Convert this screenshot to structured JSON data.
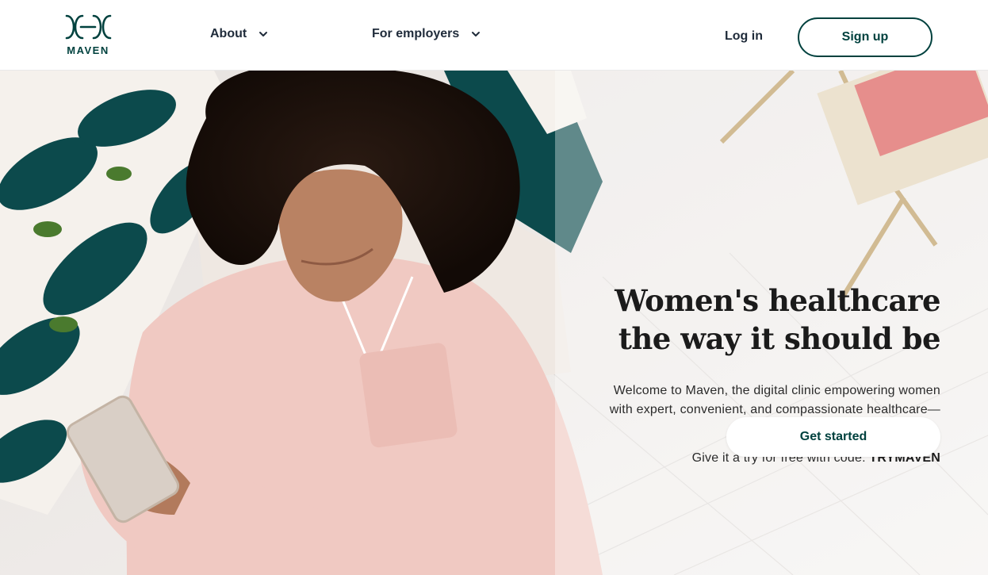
{
  "brand": {
    "name": "MAVEN",
    "color": "#00413e"
  },
  "nav": {
    "items": [
      {
        "label": "About",
        "icon": "chevron-down-icon"
      },
      {
        "label": "For employers",
        "icon": "chevron-down-icon"
      }
    ],
    "login_label": "Log in",
    "signup_label": "Sign up"
  },
  "hero": {
    "headline_line1": "Women's healthcare",
    "headline_line2": "the way it should be",
    "subtext": "Welcome to Maven, the digital clinic empowering women with expert, convenient, and compassionate healthcare—anytime, anywhere.",
    "promo_prefix": "Give it a try for free with code:",
    "promo_code": "TRYMAVEN",
    "cta_label": "Get started",
    "image_description_colors": {
      "pajamas": "#f0c9c2",
      "pillow_leaf": "#0c4a4c",
      "sheet": "#f3f1ef"
    }
  }
}
